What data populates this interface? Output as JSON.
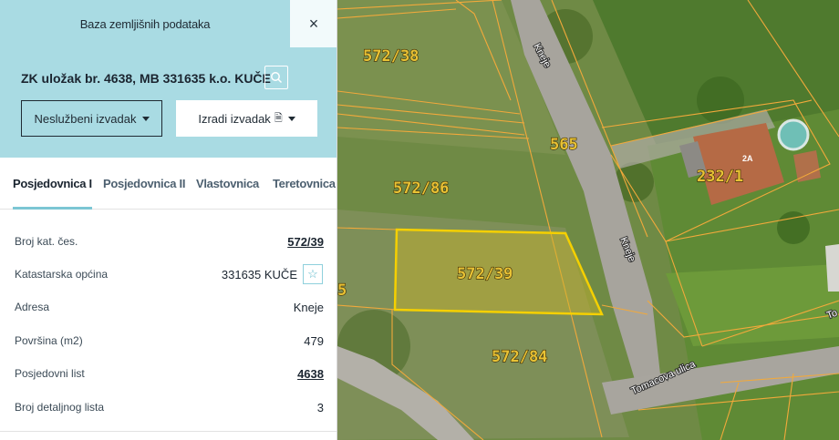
{
  "panel": {
    "title": "Baza zemljišnih podataka",
    "close_glyph": "×",
    "record_title": "ZK uložak br. 4638, MB 331635 k.o. KUČE",
    "search_icon": "search-icon",
    "buttons": {
      "unofficial_extract": "Neslužbeni izvadak",
      "create_extract": "Izradi izvadak",
      "document_glyph": "🗎"
    },
    "tabs": [
      {
        "label": "Posjedovnica I",
        "active": true
      },
      {
        "label": "Posjedovnica II",
        "active": false
      },
      {
        "label": "Vlastovnica",
        "active": false
      },
      {
        "label": "Teretovnica",
        "active": false
      }
    ],
    "rows": [
      {
        "label": "Broj kat. čes.",
        "value": "572/39",
        "link": true
      },
      {
        "label": "Katastarska općina",
        "value": "331635 KUČE",
        "link": false
      },
      {
        "label": "Adresa",
        "value": "Kneje",
        "link": false
      },
      {
        "label": "Površina (m2)",
        "value": "479",
        "link": false
      },
      {
        "label": "Posjedovni list",
        "value": "4638",
        "link": true
      },
      {
        "label": "Broj detaljnog lista",
        "value": "3",
        "link": false
      }
    ],
    "star_glyph": "☆",
    "colors": {
      "header_bg": "#a9dbe3",
      "accent": "#7cc6d4",
      "text": "#1b2530"
    }
  },
  "map": {
    "parcels": [
      "572/38",
      "565",
      "572/86",
      "232/1",
      "572/39",
      "572/84",
      "5"
    ],
    "house_number": "2A",
    "streets": [
      "Kneje",
      "Kneje",
      "Tomacova ulica",
      "To"
    ],
    "selected_parcel": "572/39",
    "colors": {
      "boundary": "#f2a93b",
      "selected": "#f5d000",
      "road": "#a7a49d"
    }
  }
}
